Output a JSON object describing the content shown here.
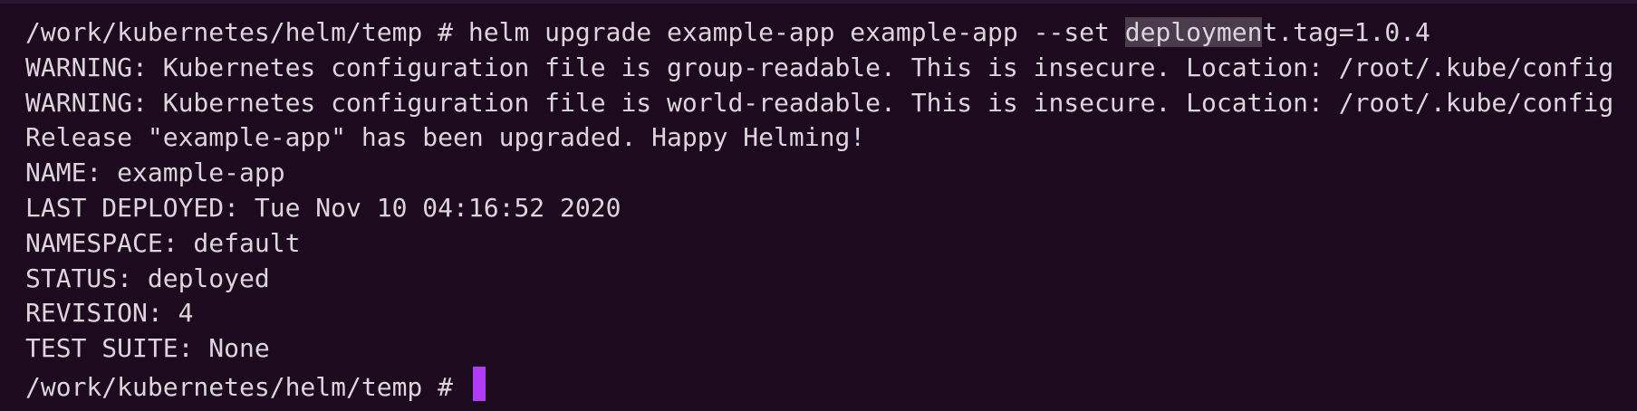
{
  "colors": {
    "background": "#1e0a1e",
    "text": "#dcd6dc",
    "selection": "#4a3c4c",
    "cursor": "#b13cf5"
  },
  "terminal": {
    "command": {
      "prompt": "/work/kubernetes/helm/temp # ",
      "before_selection": "helm upgrade example-app example-app --set ",
      "selected": "deploymen",
      "after_selection": "t.tag=1.0.4"
    },
    "output": [
      "WARNING: Kubernetes configuration file is group-readable. This is insecure. Location: /root/.kube/config",
      "WARNING: Kubernetes configuration file is world-readable. This is insecure. Location: /root/.kube/config",
      "Release \"example-app\" has been upgraded. Happy Helming!",
      "NAME: example-app",
      "LAST DEPLOYED: Tue Nov 10 04:16:52 2020",
      "NAMESPACE: default",
      "STATUS: deployed",
      "REVISION: 4",
      "TEST SUITE: None"
    ],
    "current_prompt": "/work/kubernetes/helm/temp # "
  }
}
